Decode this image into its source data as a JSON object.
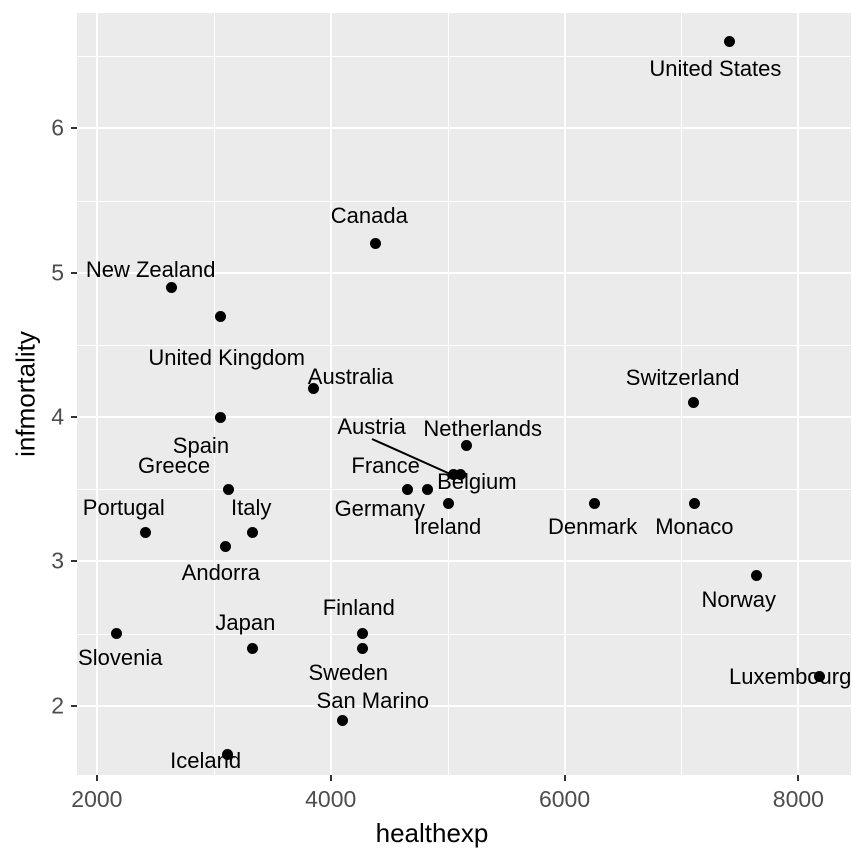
{
  "chart_data": {
    "type": "scatter",
    "title": "",
    "xlabel": "healthexp",
    "ylabel": "infmortality",
    "xlim": [
      1830,
      8450
    ],
    "ylim": [
      1.52,
      6.8
    ],
    "xticks": [
      2000,
      4000,
      6000,
      8000
    ],
    "yticks": [
      2,
      3,
      4,
      5,
      6
    ],
    "grid": true,
    "legend": "none",
    "point_color": "#000000",
    "panel_background": "#EBEBEB",
    "gridline_color": "#FFFFFF",
    "points": [
      {
        "label": "United States",
        "x": 7410,
        "y": 6.6,
        "lx": 7290,
        "ly": 6.41,
        "anchor": "c"
      },
      {
        "label": "Canada",
        "x": 4380,
        "y": 5.2,
        "lx": 4330,
        "ly": 5.39,
        "anchor": "c"
      },
      {
        "label": "New Zealand",
        "x": 2640,
        "y": 4.9,
        "lx": 2460,
        "ly": 5.02,
        "anchor": "c"
      },
      {
        "label": "United Kingdom",
        "x": 3060,
        "y": 4.7,
        "lx": 3110,
        "ly": 4.41,
        "anchor": "c"
      },
      {
        "label": "Australia",
        "x": 3850,
        "y": 4.2,
        "lx": 4170,
        "ly": 4.28,
        "anchor": "c"
      },
      {
        "label": "Switzerland",
        "x": 7100,
        "y": 4.1,
        "lx": 7010,
        "ly": 4.27,
        "anchor": "c"
      },
      {
        "label": "Spain",
        "x": 3060,
        "y": 4.0,
        "lx": 2890,
        "ly": 3.8,
        "anchor": "c"
      },
      {
        "label": "Netherlands",
        "x": 5160,
        "y": 3.8,
        "lx": 5300,
        "ly": 3.92,
        "anchor": "c"
      },
      {
        "label": "Austria",
        "x": 5050,
        "y": 3.6,
        "lx": 4350,
        "ly": 3.93,
        "anchor": "c",
        "leader": true
      },
      {
        "label": "Belgium",
        "x": 5110,
        "y": 3.6,
        "lx": 5250,
        "ly": 3.55,
        "anchor": "c"
      },
      {
        "label": "Greece",
        "x": 3130,
        "y": 3.5,
        "lx": 2660,
        "ly": 3.66,
        "anchor": "c"
      },
      {
        "label": "France",
        "x": 4660,
        "y": 3.5,
        "lx": 4470,
        "ly": 3.66,
        "anchor": "c"
      },
      {
        "label": "Germany",
        "x": 4830,
        "y": 3.5,
        "lx": 4420,
        "ly": 3.36,
        "anchor": "c"
      },
      {
        "label": "Denmark",
        "x": 6260,
        "y": 3.4,
        "lx": 6240,
        "ly": 3.24,
        "anchor": "c"
      },
      {
        "label": "Monaco",
        "x": 7110,
        "y": 3.4,
        "lx": 7110,
        "ly": 3.24,
        "anchor": "c"
      },
      {
        "label": "Italy",
        "x": 3330,
        "y": 3.2,
        "lx": 3320,
        "ly": 3.37,
        "anchor": "c"
      },
      {
        "label": "Portugal",
        "x": 2420,
        "y": 3.2,
        "lx": 2230,
        "ly": 3.37,
        "anchor": "c"
      },
      {
        "label": "Ireland",
        "x": 5010,
        "y": 3.4,
        "lx": 5000,
        "ly": 3.24,
        "anchor": "c"
      },
      {
        "label": "Andorra",
        "x": 3100,
        "y": 3.1,
        "lx": 3060,
        "ly": 2.92,
        "anchor": "c"
      },
      {
        "label": "Norway",
        "x": 7640,
        "y": 2.9,
        "lx": 7490,
        "ly": 2.73,
        "anchor": "c"
      },
      {
        "label": "Slovenia",
        "x": 2170,
        "y": 2.5,
        "lx": 2200,
        "ly": 2.33,
        "anchor": "c"
      },
      {
        "label": "Finland",
        "x": 4270,
        "y": 2.5,
        "lx": 4240,
        "ly": 2.68,
        "anchor": "c"
      },
      {
        "label": "Japan",
        "x": 3330,
        "y": 2.4,
        "lx": 3270,
        "ly": 2.57,
        "anchor": "c"
      },
      {
        "label": "Sweden",
        "x": 4270,
        "y": 2.4,
        "lx": 4150,
        "ly": 2.23,
        "anchor": "c"
      },
      {
        "label": "Luxembourg",
        "x": 8180,
        "y": 2.2,
        "lx": 7930,
        "ly": 2.2,
        "anchor": "c"
      },
      {
        "label": "San Marino",
        "x": 4100,
        "y": 1.9,
        "lx": 4360,
        "ly": 2.03,
        "anchor": "c"
      },
      {
        "label": "Iceland",
        "x": 3120,
        "y": 1.66,
        "lx": 2930,
        "ly": 1.62,
        "anchor": "c"
      }
    ]
  },
  "axes": {
    "x_title": "healthexp",
    "y_title": "infmortality",
    "x_tick_labels": [
      "2000",
      "4000",
      "6000",
      "8000"
    ],
    "y_tick_labels": [
      "2",
      "3",
      "4",
      "5",
      "6"
    ]
  }
}
